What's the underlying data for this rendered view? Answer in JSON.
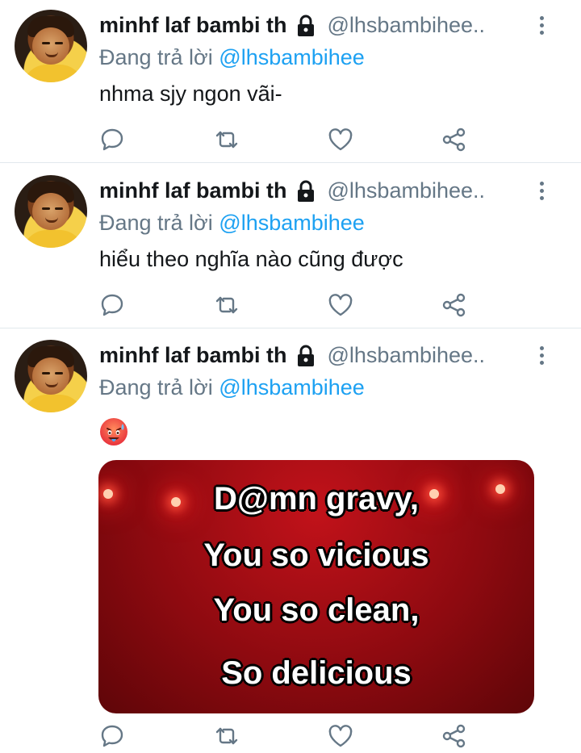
{
  "tweets": [
    {
      "display_name": "minhf laf bambi th",
      "handle": "@lhsbambihee..",
      "reply_prefix": "Đang trả lời",
      "reply_to": "@lhsbambihee",
      "text": "nhma sjy ngon vãi-"
    },
    {
      "display_name": "minhf laf bambi th",
      "handle": "@lhsbambihee..",
      "reply_prefix": "Đang trả lời",
      "reply_to": "@lhsbambihee",
      "text": "hiểu theo nghĩa nào cũng được"
    },
    {
      "display_name": "minhf laf bambi th",
      "handle": "@lhsbambihee..",
      "reply_prefix": "Đang trả lời",
      "reply_to": "@lhsbambihee",
      "emoji": "hot-face-emoji",
      "media": {
        "lines": [
          "D@mn gravy,",
          "You so vicious",
          "You so clean,",
          "So delicious"
        ]
      }
    }
  ],
  "icons": {
    "lock": "lock-icon",
    "more": "more-vertical-icon",
    "reply": "reply-icon",
    "retweet": "retweet-icon",
    "like": "heart-icon",
    "share": "share-icon"
  },
  "colors": {
    "text": "#14171a",
    "secondary": "#657786",
    "mention": "#1da1f2",
    "divider": "#e1e8ed",
    "media_bg": "#a50e16"
  }
}
